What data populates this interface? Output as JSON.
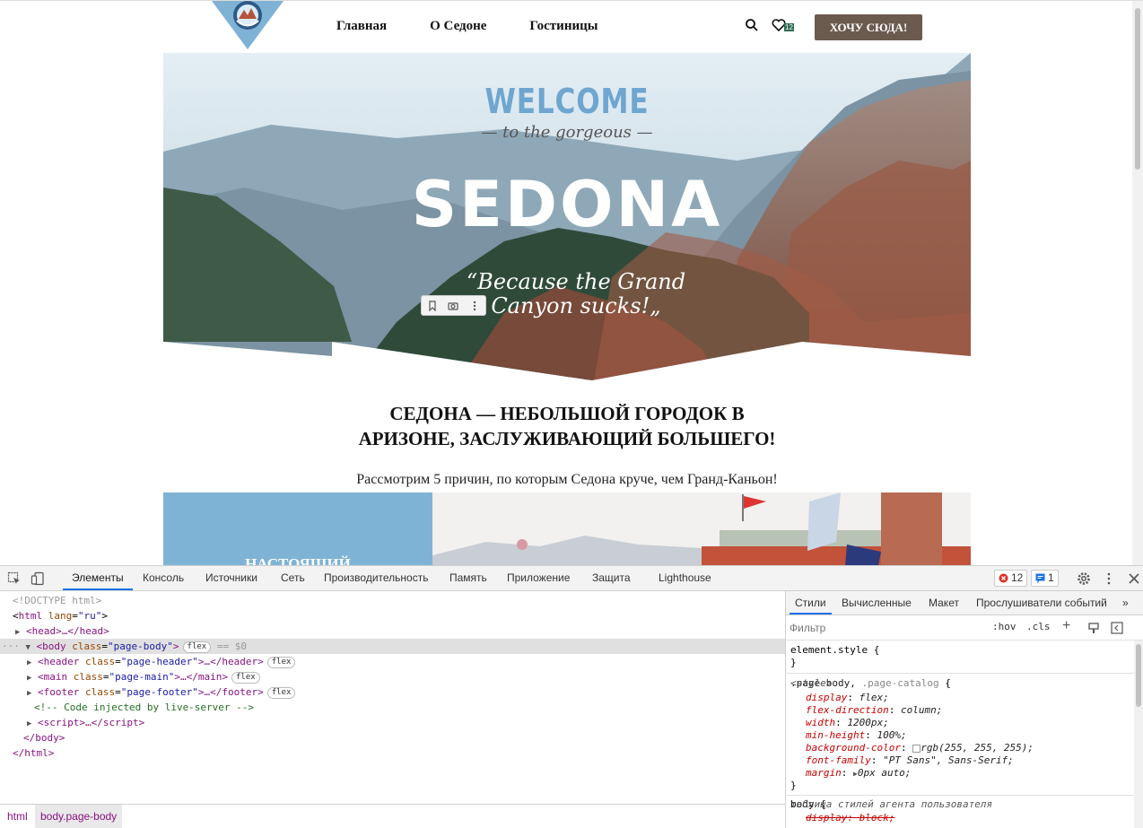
{
  "site": {
    "nav": [
      "Главная",
      "О Седоне",
      "Гостиницы"
    ],
    "cta_label": "ХОЧУ СЮДА!",
    "favorites_count": "12",
    "logo_text": "CITY OF SEDONA",
    "hero": {
      "welcome": "WELCOME",
      "subtitle": "— to the gorgeous —",
      "title": "SEDONA",
      "quote_line1": "“Because the Grand",
      "quote_line2": "Canyon sucks!„"
    },
    "headline_line1": "СЕДОНА — НЕБОЛЬШОЙ ГОРОДОК В",
    "headline_line2": "АРИЗОНЕ, ЗАСЛУЖИВАЮЩИЙ БОЛЬШЕГО!",
    "subline": "Рассмотрим 5 причин, по которым Седона круче, чем Гранд-Каньон!",
    "card_title": "НАСТОЯЩИЙ"
  },
  "devtools": {
    "tabs": [
      "Элементы",
      "Консоль",
      "Источники",
      "Сеть",
      "Производительность",
      "Память",
      "Приложение",
      "Защита",
      "Lighthouse"
    ],
    "errors_count": "12",
    "messages_count": "1",
    "dom": {
      "doctype": "<!DOCTYPE html>",
      "html_open": "html",
      "html_lang_attr": "lang",
      "html_lang_val": "\"ru\"",
      "head": "head",
      "body_tag": "body",
      "body_class_val": "\"page-body\"",
      "eq_text": "== $0",
      "header_class_val": "\"page-header\"",
      "main_class_val": "\"page-main\"",
      "footer_class_val": "\"page-footer\"",
      "comment": "<!-- Code injected by live-server -->",
      "flex_pill": "flex"
    },
    "breadcrumbs": [
      "html",
      "body.page-body"
    ],
    "styles_tabs": [
      "Стили",
      "Вычисленные",
      "Макет",
      "Прослушиватели событий"
    ],
    "filter_placeholder": "Фильтр",
    "hov": ":hov",
    "cls": ".cls",
    "rules": {
      "element_style": "element.style {",
      "selector1": ".page-body,",
      "selector1b": ".page-catalog",
      "source1": "<style>",
      "props": [
        {
          "name": "display",
          "value": "flex;"
        },
        {
          "name": "flex-direction",
          "value": "column;"
        },
        {
          "name": "width",
          "value": "1200px;"
        },
        {
          "name": "min-height",
          "value": "100%;"
        },
        {
          "name": "background-color",
          "value": "rgb(255, 255, 255);"
        },
        {
          "name": "font-family",
          "value": "\"PT Sans\", Sans-Serif;"
        },
        {
          "name": "margin",
          "value": "0px auto;"
        }
      ],
      "selector2": "body {",
      "source2": "таблица стилей агента пользователя",
      "prop2": "display: block;"
    }
  }
}
